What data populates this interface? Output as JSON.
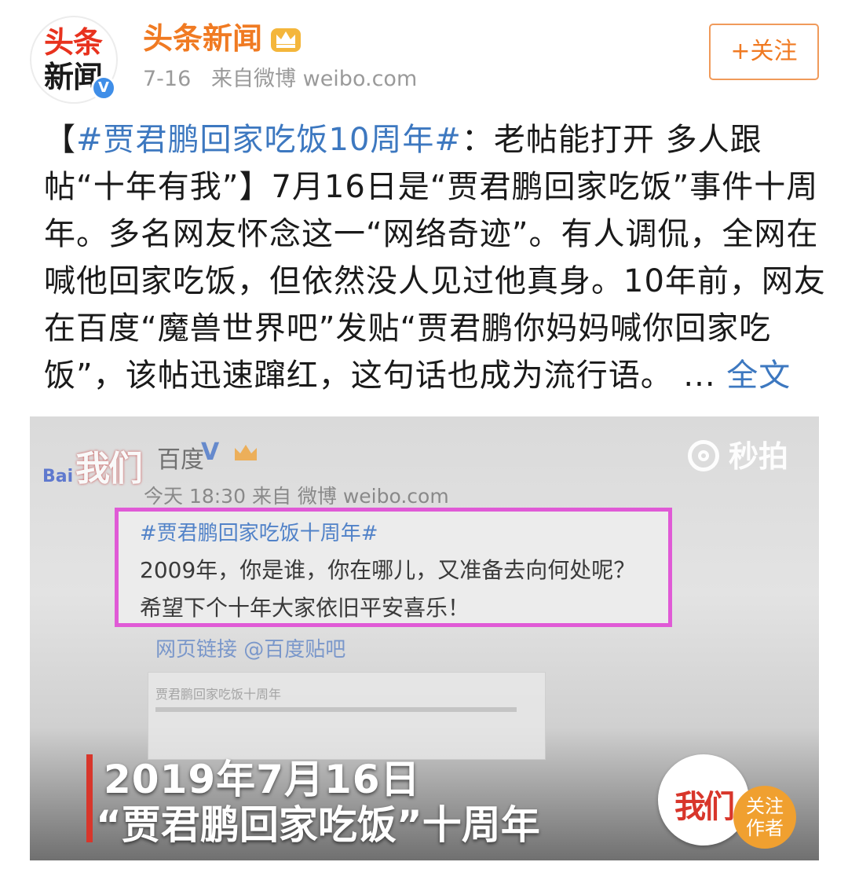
{
  "account": {
    "avatar_line1": "头条",
    "avatar_line2": "新闻",
    "name": "头条新闻",
    "date": "7-16",
    "source": "来自微博 weibo.com",
    "verified_glyph": "V",
    "crown_icon": "crown-icon"
  },
  "follow_button": {
    "label": "+关注"
  },
  "post": {
    "lines": [
      {
        "parts": [
          {
            "t": "【",
            "c": "normal"
          },
          {
            "t": "#贾君鹏回家吃饭10周年#",
            "c": "hashtag"
          },
          {
            "t": "：老帖能打开 多人跟",
            "c": "normal"
          }
        ]
      },
      {
        "parts": [
          {
            "t": "帖“十年有我”】7月16日是“贾君鹏回家吃饭”事件十周",
            "c": "normal"
          }
        ]
      },
      {
        "parts": [
          {
            "t": "年。多名网友怀念这一“网络奇迹”。有人调侃，全网在",
            "c": "normal"
          }
        ]
      },
      {
        "parts": [
          {
            "t": "喊他回家吃饭，但依然没人见过他真身。10年前，网友",
            "c": "normal"
          }
        ]
      },
      {
        "parts": [
          {
            "t": "在百度“魔兽世界吧”发贴“贾君鹏你妈妈喊你回家吃",
            "c": "normal"
          }
        ]
      },
      {
        "parts": [
          {
            "t": "饭”，该帖迅速蹿红，这句话也成为流行语。 ... ",
            "c": "normal"
          },
          {
            "t": "全文",
            "c": "more"
          }
        ]
      }
    ]
  },
  "video": {
    "watermark": "秒拍",
    "logo": "我们",
    "baidu": "Bai",
    "inner_account": "百度",
    "inner_v": "V",
    "inner_time": "今天 18:30 来自 微博 weibo.com",
    "inner_hashtag": "#贾君鹏回家吃饭十周年#",
    "inner_line1": "2009年，你是谁，你在哪儿，又准备去向何处呢？",
    "inner_line2": "希望下个十年大家依旧平安喜乐！",
    "inner_link": "网页链接 @百度贴吧",
    "inner_card_title": "贾君鹏回家吃饭十周年",
    "caption_line1": "2019年7月16日",
    "caption_line2": "“贾君鹏回家吃饭”十周年",
    "author_logo": "我们",
    "follow_author_1": "关注",
    "follow_author_2": "作者"
  },
  "colors": {
    "accent_orange": "#f07a22",
    "link_blue": "#3d78c0",
    "highlight_pink": "#e05ad6",
    "caption_red": "#d8362b"
  }
}
